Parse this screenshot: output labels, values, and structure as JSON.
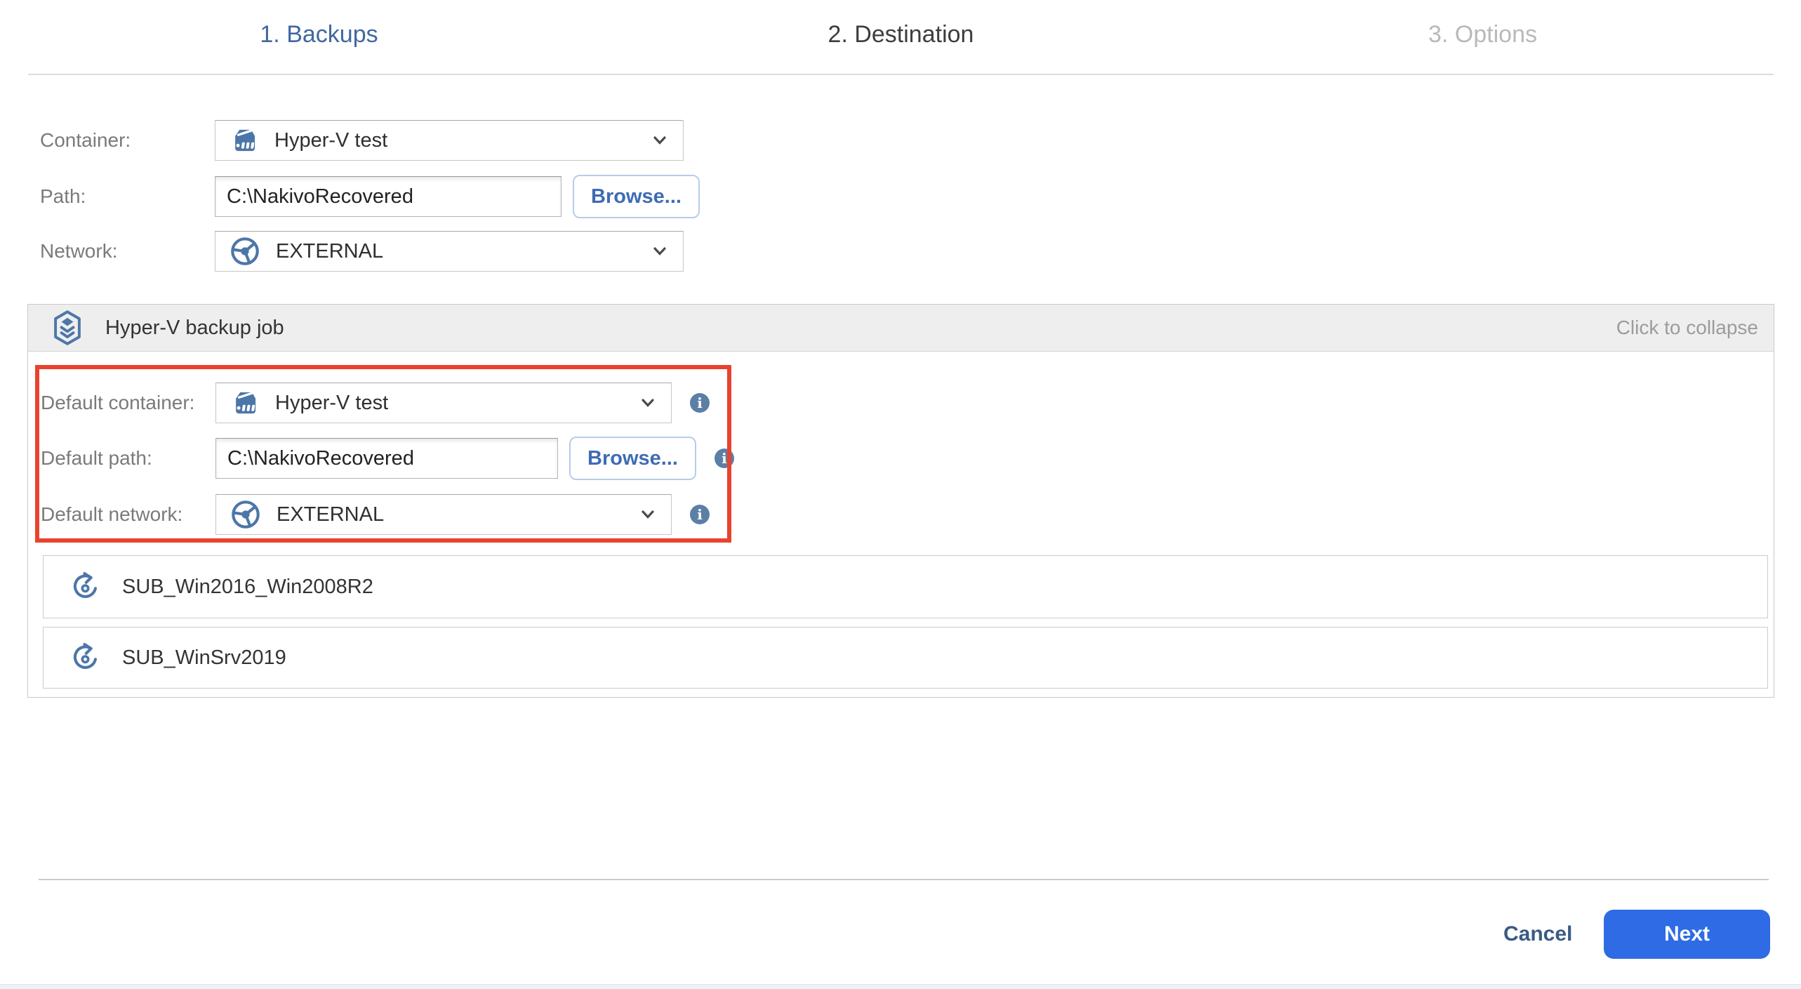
{
  "steps": [
    {
      "label": "1. Backups",
      "state": "done"
    },
    {
      "label": "2. Destination",
      "state": "active"
    },
    {
      "label": "3. Options",
      "state": "future"
    }
  ],
  "top_form": {
    "container": {
      "label": "Container:",
      "value": "Hyper-V test",
      "icon": "hyperv-host-icon"
    },
    "path": {
      "label": "Path:",
      "value": "C:\\NakivoRecovered",
      "browse_label": "Browse..."
    },
    "network": {
      "label": "Network:",
      "value": "EXTERNAL",
      "icon": "network-icon"
    }
  },
  "job_panel": {
    "icon": "backup-job-icon",
    "title": "Hyper-V backup job",
    "collapse_hint": "Click to collapse",
    "defaults": {
      "container": {
        "label": "Default container:",
        "value": "Hyper-V test",
        "icon": "hyperv-host-icon",
        "info_icon": "info-icon"
      },
      "path": {
        "label": "Default path:",
        "value": "C:\\NakivoRecovered",
        "browse_label": "Browse...",
        "info_icon": "info-icon"
      },
      "network": {
        "label": "Default network:",
        "value": "EXTERNAL",
        "icon": "network-icon",
        "info_icon": "info-icon"
      }
    },
    "vms": [
      {
        "name": "SUB_Win2016_Win2008R2",
        "icon": "vm-backup-icon"
      },
      {
        "name": "SUB_WinSrv2019",
        "icon": "vm-backup-icon"
      }
    ]
  },
  "footer": {
    "cancel_label": "Cancel",
    "next_label": "Next"
  },
  "colors": {
    "step-done-blue": "#4168a0",
    "step-active": "#3d3d3d",
    "step-future": "#b9b9b9",
    "link-blue": "#3e6cb4",
    "icon-blue": "#4d76a8",
    "info-blue": "#5b7fa6",
    "annotation-red": "#e8432e",
    "cancel-blue": "#3a5b85",
    "primary-blue": "#2e6be4"
  }
}
